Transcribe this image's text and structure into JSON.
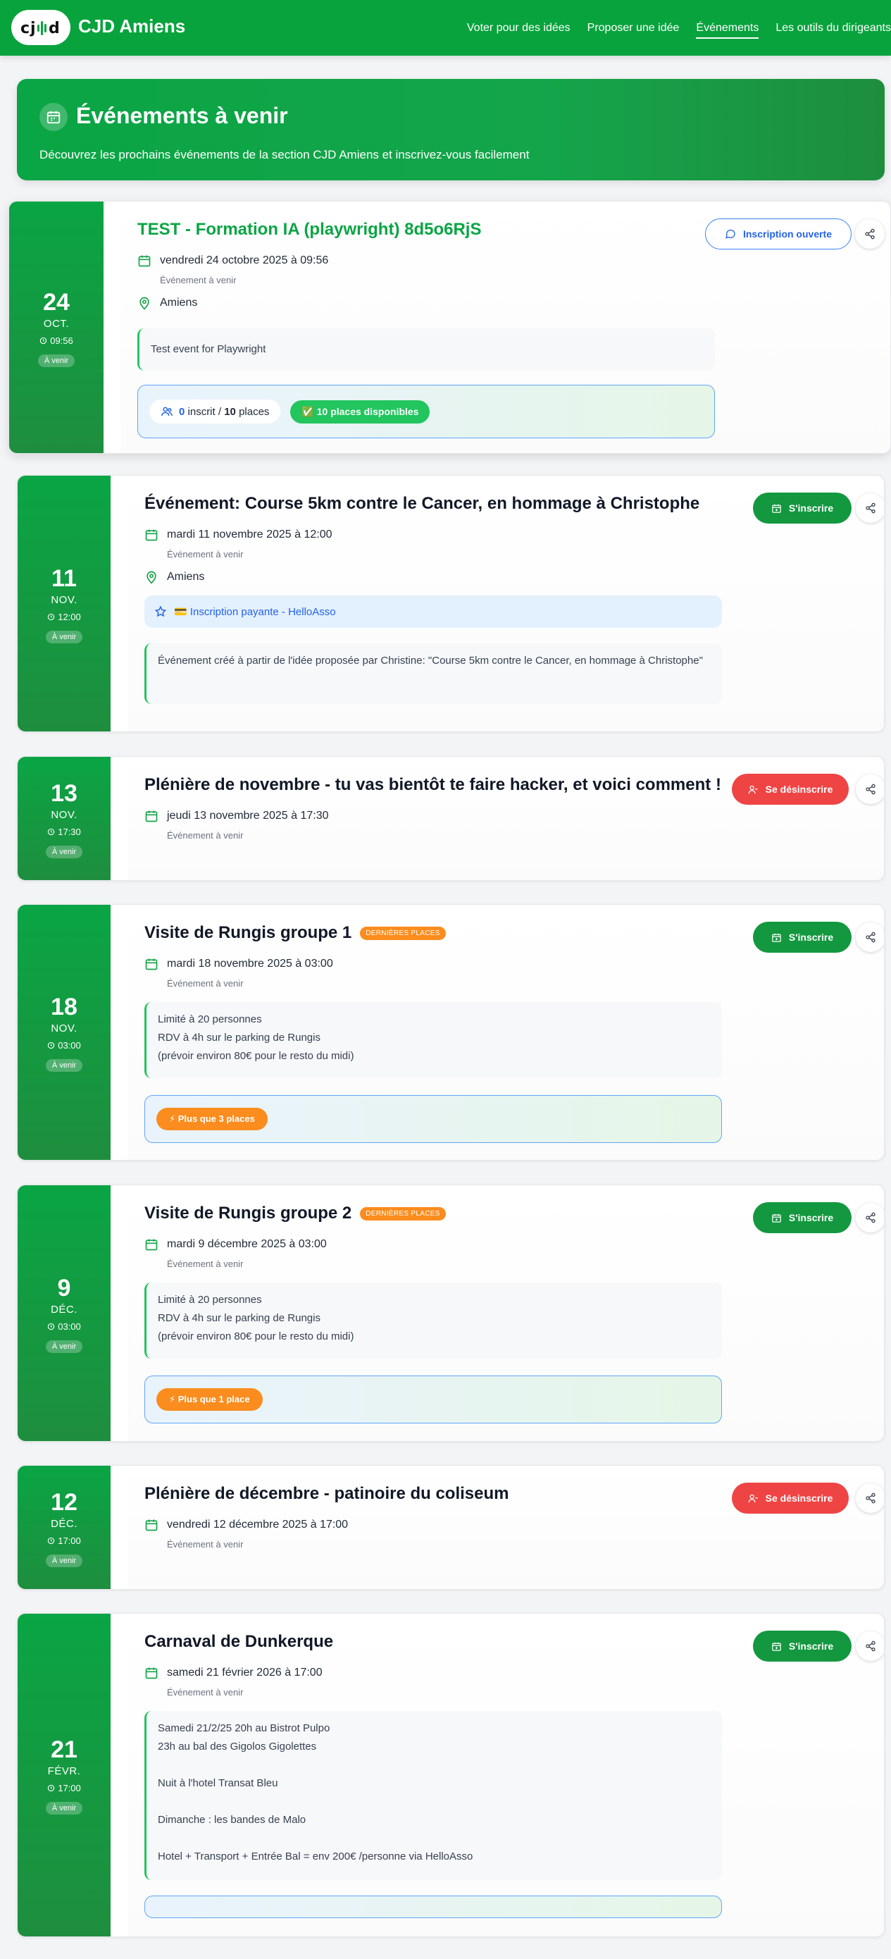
{
  "header": {
    "brand": "CJD Amiens",
    "logo_text": "CJD",
    "nav": [
      "Voter pour des idées",
      "Proposer une idée",
      "Événements",
      "Les outils du dirigeants"
    ]
  },
  "hero": {
    "title": "Événements à venir",
    "subtitle": "Découvrez les prochains événements de la section CJD Amiens et inscrivez-vous facilement"
  },
  "colors": {
    "primary_green": "#08a33d",
    "red": "#ef4444",
    "orange": "#fb8c1e",
    "blue": "#2563eb"
  },
  "events": [
    {
      "day": "24",
      "month": "OCT.",
      "time": "09:56",
      "badge": "À venir",
      "title": "TEST - Formation IA (playwright) 8d5o6RjS",
      "date": "vendredi 24 octobre 2025 à 09:56",
      "status": "Événement à venir",
      "location": "Amiens",
      "description": "Test event for Playwright",
      "registered_count": "0",
      "registered_label": "inscrit /",
      "places_count": "10",
      "places_label": "places",
      "available": "✅ 10 places disponibles",
      "action": "Inscription ouverte"
    },
    {
      "day": "11",
      "month": "NOV.",
      "time": "12:00",
      "badge": "À venir",
      "title": "Événement: Course 5km contre le Cancer, en hommage à Christophe",
      "date": "mardi 11 novembre 2025 à 12:00",
      "status": "Événement à venir",
      "location": "Amiens",
      "payment": "💳 Inscription payante - HelloAsso",
      "description": "Événement créé à partir de l'idée proposée par Christine: \"Course 5km contre le Cancer, en hommage à Christophe\"",
      "action": "S'inscrire"
    },
    {
      "day": "13",
      "month": "NOV.",
      "time": "17:30",
      "badge": "À venir",
      "title": "Plénière de novembre - tu vas bientôt te faire hacker, et voici comment !",
      "date": "jeudi 13 novembre 2025 à 17:30",
      "status": "Événement à venir",
      "action": "Se désinscrire"
    },
    {
      "day": "18",
      "month": "NOV.",
      "time": "03:00",
      "badge": "À venir",
      "title": "Visite de Rungis groupe 1",
      "tag": "DERNIÈRES PLACES",
      "date": "mardi 18 novembre 2025 à 03:00",
      "status": "Événement à venir",
      "description": "Limité à 20 personnes\nRDV à 4h sur le parking de Rungis\n(prévoir environ 80€ pour le resto du midi)",
      "remaining": "⚡ Plus que 3 places",
      "action": "S'inscrire"
    },
    {
      "day": "9",
      "month": "DÉC.",
      "time": "03:00",
      "badge": "À venir",
      "title": "Visite de Rungis groupe 2",
      "tag": "DERNIÈRES PLACES",
      "date": "mardi 9 décembre 2025 à 03:00",
      "status": "Événement à venir",
      "description": "Limité à 20 personnes\nRDV à 4h sur le parking de Rungis\n(prévoir environ 80€ pour le resto du midi)",
      "remaining": "⚡ Plus que 1 place",
      "action": "S'inscrire"
    },
    {
      "day": "12",
      "month": "DÉC.",
      "time": "17:00",
      "badge": "À venir",
      "title": "Plénière de décembre - patinoire du coliseum",
      "date": "vendredi 12 décembre 2025 à 17:00",
      "status": "Événement à venir",
      "action": "Se désinscrire"
    },
    {
      "day": "21",
      "month": "FÉVR.",
      "time": "17:00",
      "badge": "À venir",
      "title": "Carnaval de Dunkerque",
      "date": "samedi 21 février 2026 à 17:00",
      "status": "Événement à venir",
      "description": "Samedi 21/2/25 20h au Bistrot Pulpo\n23h au bal des Gigolos Gigolettes\n\nNuit à l'hotel Transat Bleu\n\nDimanche : les bandes de Malo\n\nHotel + Transport + Entrée Bal = env 200€ /personne via HelloAsso",
      "action": "S'inscrire"
    }
  ]
}
